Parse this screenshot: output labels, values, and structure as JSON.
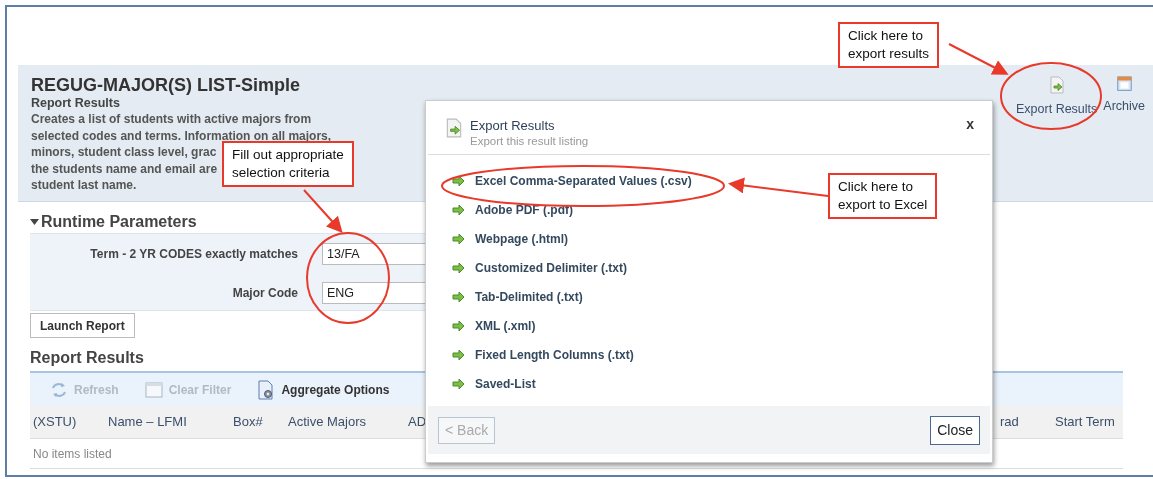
{
  "header": {
    "title": "REGUG-MAJOR(S) LIST-Simple",
    "subtitle": "Report Results",
    "description_lines": [
      "Creates a list of students with active majors from",
      "selected codes and terms. Information on all majors,",
      "minors, student class level, grac",
      "the students name and email are",
      "student last name."
    ]
  },
  "actions": [
    {
      "label": "Export Results",
      "kind": "export"
    },
    {
      "label": "Archive",
      "kind": "archive"
    }
  ],
  "runtime_parameters": {
    "title": "Runtime Parameters",
    "expanded": true,
    "fields": [
      {
        "label": "Term - 2 YR CODES exactly matches",
        "value": "13/FA"
      },
      {
        "label": "Major Code",
        "value": "ENG"
      }
    ]
  },
  "launch_button": "Launch Report",
  "results": {
    "title": "Report Results",
    "toolbar": [
      {
        "label": "Refresh",
        "kind": "refresh",
        "disabled": true
      },
      {
        "label": "Clear Filter",
        "kind": "clear",
        "disabled": true
      },
      {
        "label": "Aggregate Options",
        "kind": "aggregate",
        "disabled": false
      }
    ],
    "columns": [
      "(XSTU)",
      "Name – LFMI",
      "Box#",
      "Active Majors",
      "AD",
      "rad",
      "Start Term"
    ],
    "empty_text": "No items listed"
  },
  "dialog": {
    "title": "Export Results",
    "subtitle": "Export this result listing",
    "close": "x",
    "options": [
      "Excel Comma-Separated Values (.csv)",
      "Adobe PDF (.pdf)",
      "Webpage (.html)",
      "Customized Delimiter (.txt)",
      "Tab-Delimited (.txt)",
      "XML (.xml)",
      "Fixed Length Columns (.txt)",
      "Saved-List"
    ],
    "back": {
      "label": "< Back",
      "disabled": true
    },
    "close_button": "Close"
  },
  "callouts": [
    "Click here to\nexport results",
    "Fill out appropriate\nselection criteria",
    "Click here to\nexport to Excel"
  ]
}
